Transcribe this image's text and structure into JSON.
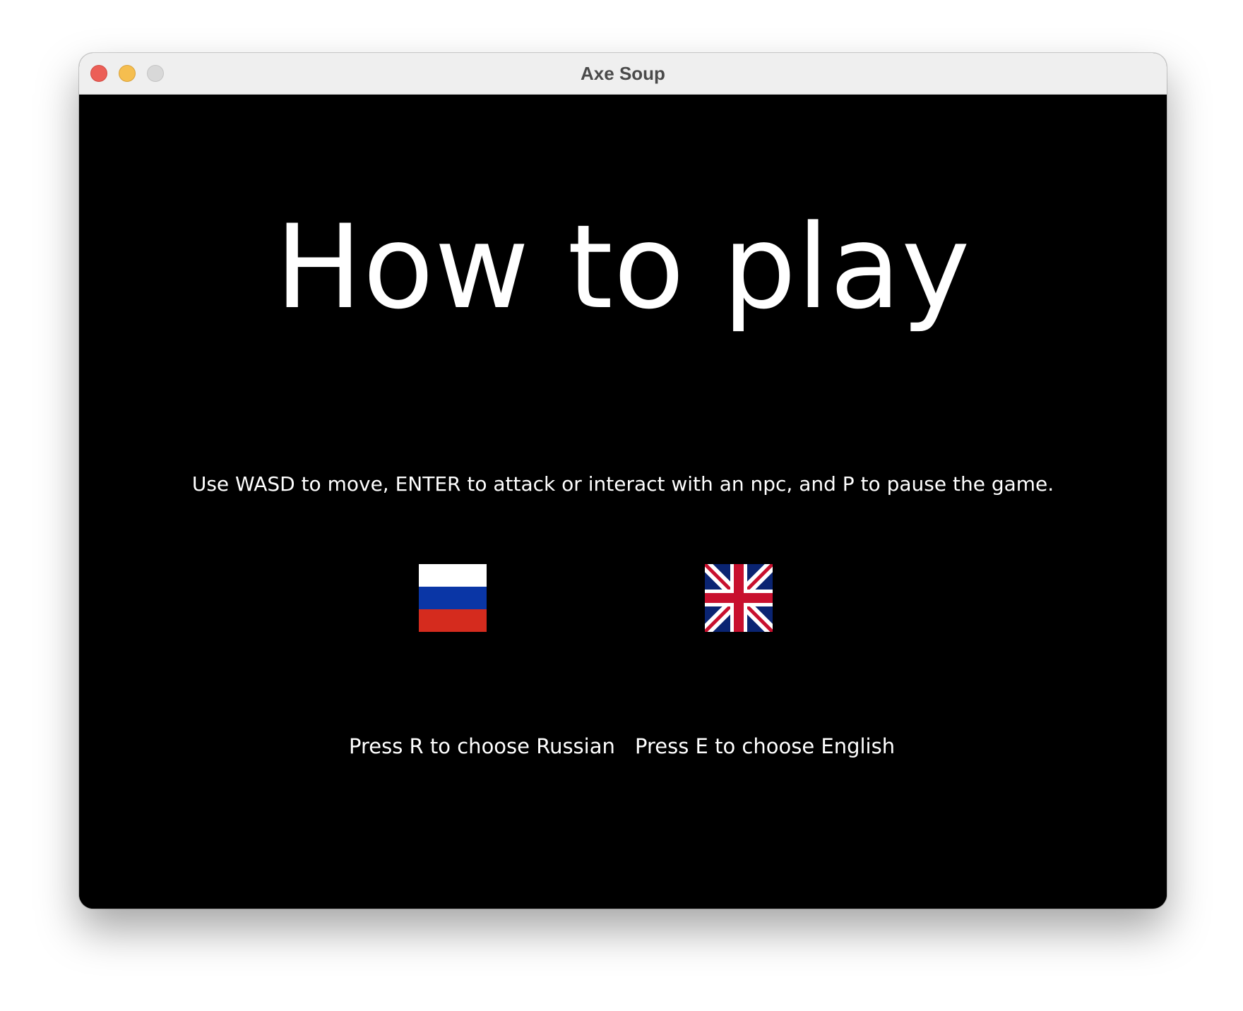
{
  "window": {
    "title": "Axe Soup"
  },
  "screen": {
    "heading": "How to play",
    "instructions": "Use WASD to move, ENTER to attack or interact with an npc, and P to pause the game.",
    "languages": [
      {
        "flag_icon": "russian-flag-icon",
        "label": "Press R to choose Russian"
      },
      {
        "flag_icon": "uk-flag-icon",
        "label": "Press E to choose English"
      }
    ]
  },
  "colors": {
    "background": "#000000",
    "text": "#ffffff",
    "ru_white": "#ffffff",
    "ru_blue": "#0a36a6",
    "ru_red": "#d52b1e",
    "uk_blue": "#0a2472",
    "uk_red": "#c8102e"
  }
}
